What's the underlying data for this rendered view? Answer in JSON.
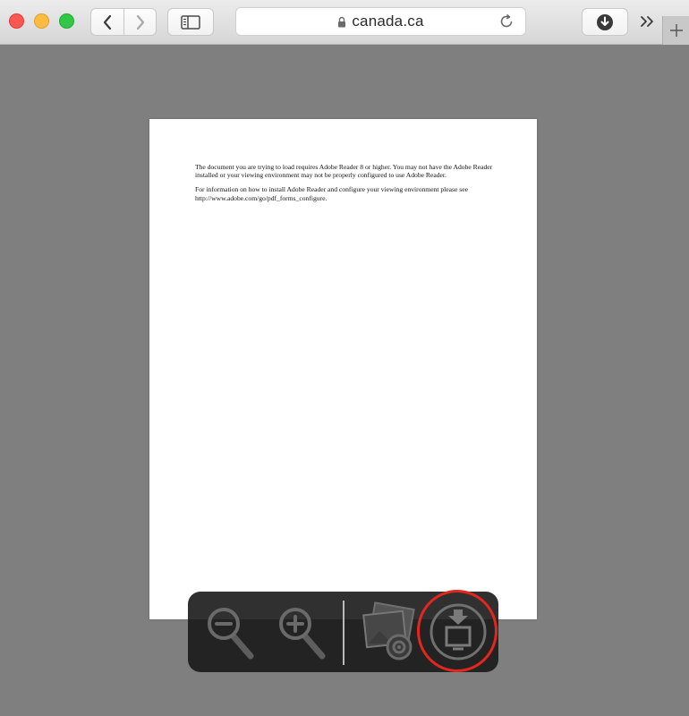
{
  "browser": {
    "url": "canada.ca",
    "icons": {
      "back": "chevron-left-icon",
      "forward": "chevron-right-icon",
      "sidebar": "sidebar-icon",
      "lock": "lock-icon",
      "reload": "reload-icon",
      "downloads": "download-icon",
      "overflow": "double-chevron-icon",
      "new_tab": "plus-icon"
    }
  },
  "document": {
    "paragraphs": [
      "The document you are trying to load requires Adobe Reader 8 or higher. You may not have the Adobe Reader installed or your viewing environment may not be properly configured to use Adobe Reader.",
      "For information on how to install Adobe Reader and configure your viewing environment please see  http://www.adobe.com/go/pdf_forms_configure."
    ]
  },
  "pdf_hud": {
    "icons": [
      "zoom-out-icon",
      "zoom-in-icon",
      "open-in-preview-icon",
      "download-save-icon"
    ],
    "highlight_color": "#e3271f"
  }
}
